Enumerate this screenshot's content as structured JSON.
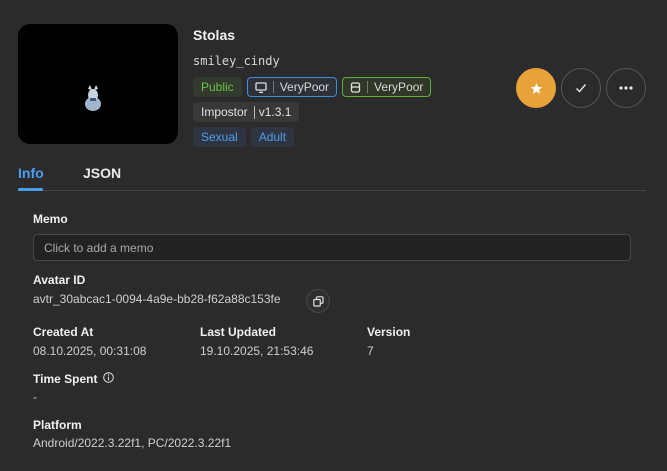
{
  "avatar": {
    "name": "Stolas",
    "author": "smiley_cindy",
    "release_status": "Public",
    "pc_performance": "VeryPoor",
    "android_performance": "VeryPoor",
    "tag_impostor": "Impostor",
    "impostor_version": "v1.3.1",
    "content_tags": [
      "Sexual",
      "Adult"
    ]
  },
  "actions": {
    "favorite_icon": "star-icon",
    "select_icon": "check-icon",
    "more_icon": "more-dots-icon"
  },
  "tabs": [
    {
      "label": "Info",
      "active": true
    },
    {
      "label": "JSON",
      "active": false
    }
  ],
  "info": {
    "memo_label": "Memo",
    "memo_placeholder": "Click to add a memo",
    "memo_value": "",
    "avatar_id_label": "Avatar ID",
    "avatar_id": "avtr_30abcac1-0094-4a9e-bb28-f62a88c153fe",
    "created_label": "Created At",
    "created_value": "08.10.2025, 00:31:08",
    "updated_label": "Last Updated",
    "updated_value": "19.10.2025, 21:53:46",
    "version_label": "Version",
    "version_value": "7",
    "time_spent_label": "Time Spent",
    "time_spent_value": "-",
    "platform_label": "Platform",
    "platform_value": "Android/2022.3.22f1, PC/2022.3.22f1"
  },
  "colors": {
    "accent": "#4a9ef0",
    "favorite": "#e8a23a",
    "public_green": "#6cc24a",
    "background": "#2b2b2b"
  }
}
